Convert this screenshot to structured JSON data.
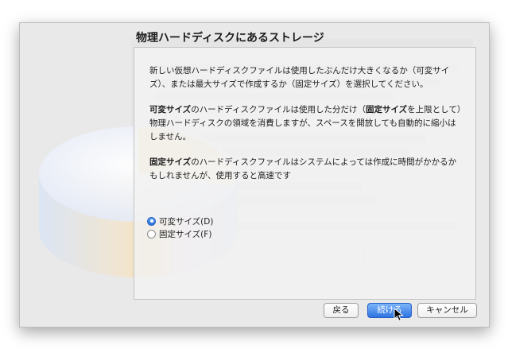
{
  "dialog": {
    "title": "物理ハードディスクにあるストレージ",
    "paragraphs": {
      "p1": "新しい仮想ハードディスクファイルは使用したぶんだけ大きくなるか（可変サイズ）、または最大サイズで作成するか（固定サイズ）を選択してください。",
      "p2_bold": "可変サイズ",
      "p2_mid": "のハードディスクファイルは使用した分だけ（",
      "p2_bold2": "固定サイズ",
      "p2_rest": "を上限として）物理ハードディスクの領域を消費しますが、スペースを開放しても自動的に縮小はしません。",
      "p3_bold": "固定サイズ",
      "p3_rest": "のハードディスクファイルはシステムによっては作成に時間がかかるかもしれませんが、使用すると高速です"
    },
    "options": [
      {
        "label": "可変サイズ(D)",
        "selected": true
      },
      {
        "label": "固定サイズ(F)",
        "selected": false
      }
    ],
    "buttons": {
      "back": "戻る",
      "continue": "続ける",
      "cancel": "キャンセル"
    }
  },
  "colors": {
    "accent": "#2c73e0",
    "dialog_bg": "#e9e9e9"
  }
}
